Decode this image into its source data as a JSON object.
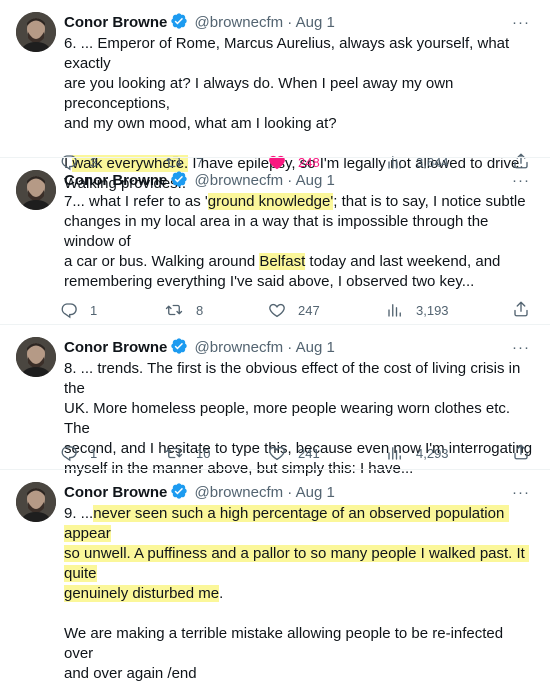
{
  "tweets": [
    {
      "name": "Conor Browne",
      "handle": "@brownecfm",
      "dot": "·",
      "date": "Aug 1",
      "more": "···",
      "segments": [
        {
          "text": "6. ... Emperor of Rome, Marcus Aurelius, always ask yourself, what exactly\nare you looking at? I always do. When I peel away my own preconceptions,\nand my own mood, what am I looking at?\n\nI ",
          "hl": false
        },
        {
          "text": "walk everywhere.",
          "hl": true
        },
        {
          "text": " I have epilepsy, so I'm legally not allowed to drive.\nWalking provides..",
          "hl": false
        }
      ],
      "replies": "3",
      "retweets": "7",
      "likes": "248",
      "liked": true,
      "views": "3,644"
    },
    {
      "name": "Conor Browne",
      "handle": "@brownecfm",
      "dot": "·",
      "date": "Aug 1",
      "more": "···",
      "segments": [
        {
          "text": "7... what I refer to as '",
          "hl": false
        },
        {
          "text": "ground knowledge'",
          "hl": true
        },
        {
          "text": "; that is to say, I notice subtle\nchanges in my local area in a way that is impossible through the window of\na car or bus. Walking around ",
          "hl": false
        },
        {
          "text": "Belfast",
          "hl": true
        },
        {
          "text": " today and last weekend, and\nremembering everything I've said above, I observed two key...",
          "hl": false
        }
      ],
      "replies": "1",
      "retweets": "8",
      "likes": "247",
      "liked": false,
      "views": "3,193"
    },
    {
      "name": "Conor Browne",
      "handle": "@brownecfm",
      "dot": "·",
      "date": "Aug 1",
      "more": "···",
      "segments": [
        {
          "text": "8. ... trends. The first is the obvious effect of the cost of living crisis in the\nUK. More homeless people, more people wearing worn clothes etc. The\nsecond, and I hesitate to type this, because even now I'm interrogating\nmyself in the manner above, but simply this: I have...",
          "hl": false
        }
      ],
      "replies": "1",
      "retweets": "10",
      "likes": "241",
      "liked": false,
      "views": "4,293"
    },
    {
      "name": "Conor Browne",
      "handle": "@brownecfm",
      "dot": "·",
      "date": "Aug 1",
      "more": "···",
      "segments": [
        {
          "text": "9. ...",
          "hl": false
        },
        {
          "text": "never seen such a high percentage of an observed population appear\nso unwell. A puffiness and a pallor to so many people I walked past. It quite\ngenuinely disturbed me",
          "hl": true
        },
        {
          "text": ".\n\nWe are making a terrible mistake allowing people to be re-infected over\nand over again /end",
          "hl": false
        }
      ]
    }
  ],
  "colors": {
    "verified": "#1d9bf0",
    "like": "#f91880",
    "highlight": "#fbf79a",
    "muted": "#536471"
  },
  "icons": [
    "reply-icon",
    "retweet-icon",
    "heart-icon",
    "views-icon",
    "share-icon",
    "verified-badge-icon",
    "more-icon"
  ]
}
